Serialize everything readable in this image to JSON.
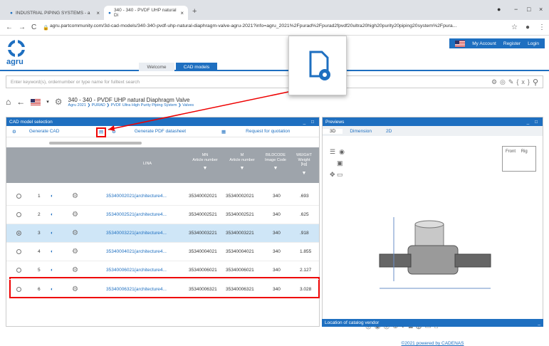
{
  "browser": {
    "tabs": [
      {
        "label": "INDUSTRIAL PIPING SYSTEMS - a"
      },
      {
        "label": "340 - 340 - PVDF UHP natural Di"
      }
    ],
    "url": "agru.partcommunity.com/3d-cad-models/340-340-pvdf-uhp-natural-diaphragm-valve-agru-2021?info=agru_2021%2Fpurad%2Fpurad2fpvdf20ultra20high20purity20piping20system%2Fpura..."
  },
  "site": {
    "logo_text": "agru",
    "tabs": [
      {
        "label": "Welcome"
      },
      {
        "label": "CAD models"
      }
    ],
    "account": {
      "my_account": "My Account",
      "register": "Register",
      "login": "Login"
    },
    "search_placeholder": "Enter keyword(s), ordernumber or type name for fulltext search",
    "breadcrumb": {
      "title": "340 - 340 - PVDF UHP natural Diaphragm Valve",
      "path": "Agru 2021 ❯ PURAD ❯ PVDF Ultra High Purity Piping System ❯ Valves"
    }
  },
  "cad_panel": {
    "title": "CAD model selection",
    "toolbar": {
      "generate_cad": "Generate CAD",
      "generate_pdf": "Generate PDF datasheet",
      "request_quote": "Request for quotation"
    },
    "columns": {
      "lina": "LINA",
      "mn": "MN\nArticle number",
      "m": "M\nArticle number",
      "bildcode": "BILDCODE\nImage Code",
      "weight": "WEIGHT\nWeight\n[kg]"
    },
    "rows": [
      {
        "n": "1",
        "lina": "35340002021{architecture4...",
        "mn": "35340002021",
        "m": "35340002021",
        "code": "340",
        "weight": ".693"
      },
      {
        "n": "2",
        "lina": "35340002521{architecture4...",
        "mn": "35340002521",
        "m": "35340002521",
        "code": "340",
        "weight": ".625"
      },
      {
        "n": "3",
        "lina": "35340003221{architecture4...",
        "mn": "35340003221",
        "m": "35340003221",
        "code": "340",
        "weight": ".918"
      },
      {
        "n": "4",
        "lina": "35340004021{architecture4...",
        "mn": "35340004021",
        "m": "35340004021",
        "code": "340",
        "weight": "1.855"
      },
      {
        "n": "5",
        "lina": "35340006021{architecture4...",
        "mn": "35340006021",
        "m": "35340006021",
        "code": "340",
        "weight": "2.127"
      },
      {
        "n": "6",
        "lina": "35340006321{architecture4...",
        "mn": "35340006321",
        "m": "35340006321",
        "code": "340",
        "weight": "3.028"
      }
    ]
  },
  "preview_panel": {
    "title": "Previews",
    "tabs": [
      {
        "label": "3D"
      },
      {
        "label": "Dimension"
      },
      {
        "label": "2D"
      }
    ],
    "cube_front": "Front",
    "cube_side": "Rig",
    "powered_by": "©2021 powered by CADENAS"
  },
  "location_panel": {
    "title": "Location of catalog vendor"
  }
}
